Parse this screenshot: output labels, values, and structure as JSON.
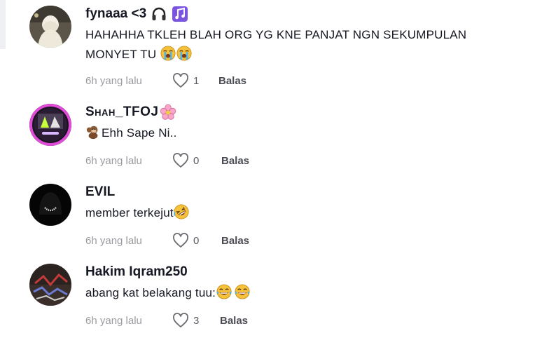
{
  "comments": [
    {
      "author": "fynaaa <3",
      "author_icons": [
        "headphones-icon",
        "music-note-icon"
      ],
      "text_lines": [
        "HAHAHHA TKLEH BLAH ORG YG KNE PANJAT NGN SEKUMPULAN",
        "MONYET TU"
      ],
      "emojis": [
        "loudly-crying-emoji",
        "loudly-crying-emoji"
      ],
      "time": "6h yang lalu",
      "likes": "1",
      "reply_label": "Balas"
    },
    {
      "author": "Shah_TFOJ",
      "author_icons": [
        "cherry-blossom-icon"
      ],
      "text_prefix_emoji": "monkey-emoji",
      "text": "Ehh Sape Ni..",
      "time": "6h yang lalu",
      "likes": "0",
      "reply_label": "Balas"
    },
    {
      "author": "EVIL",
      "text": "member terkejut",
      "emojis": [
        "rolling-laughing-emoji"
      ],
      "time": "6h yang lalu",
      "likes": "0",
      "reply_label": "Balas"
    },
    {
      "author": "Hakim Iqram250",
      "text": "abang kat belakang tuu:",
      "emojis": [
        "tears-of-joy-emoji",
        "tears-of-joy-emoji"
      ],
      "time": "6h yang lalu",
      "likes": "3",
      "reply_label": "Balas"
    }
  ],
  "colors": {
    "author": "#161823",
    "time": "#9b9ba1",
    "like_count": "#5b5c63",
    "reply": "#4b4c53",
    "emoji_yellow": "#f7c23b",
    "music_purple": "#6a3fd0"
  }
}
